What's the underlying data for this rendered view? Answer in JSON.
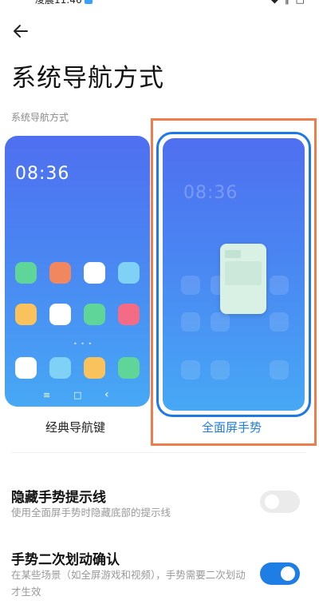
{
  "status_bar": {
    "time": "凌晨11:46",
    "icons": "◆ ∥ □"
  },
  "header": {
    "back_icon": "arrow-left-icon",
    "title": "系统导航方式"
  },
  "section": {
    "label": "系统导航方式"
  },
  "options": {
    "classic": {
      "label": "经典导航键",
      "preview_time": "08:36",
      "page_dots": "• • •",
      "nav_menu": "≡",
      "nav_home": "□",
      "nav_back": "‹",
      "selected": false
    },
    "gesture": {
      "label": "全面屏手势",
      "preview_time": "08:36",
      "selected": true
    }
  },
  "settings": {
    "hide_hint": {
      "title": "隐藏手势提示线",
      "description": "使用全面屏手势时隐藏底部的提示线",
      "enabled": false
    },
    "confirm_swipe": {
      "title": "手势二次划动确认",
      "description": "在某些场景（如全屏游戏和视频），手势需要二次划动才生效",
      "enabled": true
    }
  },
  "colors": {
    "accent": "#1f7de6",
    "highlight_frame": "#ee7d4b",
    "preview_top": "#4f6ff0",
    "preview_bottom": "#47a8f5",
    "app_icons": [
      "#5fd59a",
      "#f1875f",
      "#ffffff",
      "#7fd2f5",
      "#f9c25d",
      "#ffffff",
      "#5fd59a",
      "#f46b86",
      "#ffffff",
      "#7fd2f5",
      "#f9c25d",
      "#5fd59a"
    ]
  }
}
